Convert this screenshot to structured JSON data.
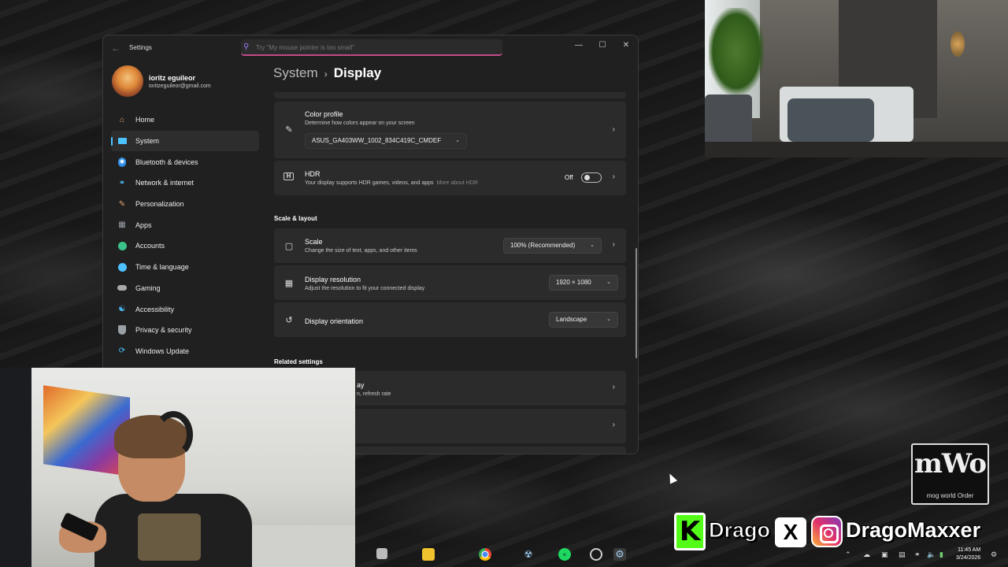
{
  "window": {
    "app_title": "Settings",
    "search_placeholder": "Try \"My mouse pointer is too small\"",
    "controls": {
      "minimize": "—",
      "maximize": "☐",
      "close": "✕"
    }
  },
  "profile": {
    "name": "ioritz eguileor",
    "email": "ioritzeguileor@gmail.com"
  },
  "sidebar": {
    "items": [
      {
        "label": "Home",
        "icon": "home-icon",
        "color": "#e8a36a"
      },
      {
        "label": "System",
        "icon": "system-icon",
        "color": "#4cc2ff"
      },
      {
        "label": "Bluetooth & devices",
        "icon": "bluetooth-icon",
        "color": "#2f8fe8"
      },
      {
        "label": "Network & internet",
        "icon": "wifi-icon",
        "color": "#4cc2ff"
      },
      {
        "label": "Personalization",
        "icon": "brush-icon",
        "color": "#e8a06a"
      },
      {
        "label": "Apps",
        "icon": "apps-icon",
        "color": "#9aa0a8"
      },
      {
        "label": "Accounts",
        "icon": "accounts-icon",
        "color": "#3ac28a"
      },
      {
        "label": "Time & language",
        "icon": "globe-icon",
        "color": "#4cc2ff"
      },
      {
        "label": "Gaming",
        "icon": "gamepad-icon",
        "color": "#aaaaaa"
      },
      {
        "label": "Accessibility",
        "icon": "accessibility-icon",
        "color": "#4cc2ff"
      },
      {
        "label": "Privacy & security",
        "icon": "shield-icon",
        "color": "#9aa0a8"
      },
      {
        "label": "Windows Update",
        "icon": "update-icon",
        "color": "#4cc2ff"
      }
    ]
  },
  "breadcrumb": {
    "parent": "System",
    "separator": "›",
    "current": "Display"
  },
  "cards": {
    "color_profile": {
      "title": "Color profile",
      "subtitle": "Determine how colors appear on your screen",
      "value": "ASUS_GA403WW_1002_834C419C_CMDEF"
    },
    "hdr": {
      "title": "HDR",
      "subtitle": "Your display supports HDR games, videos, and apps",
      "link": "More about HDR",
      "state": "Off"
    },
    "scale": {
      "title": "Scale",
      "subtitle": "Change the size of text, apps, and other items",
      "value": "100% (Recommended)"
    },
    "resolution": {
      "title": "Display resolution",
      "subtitle": "Adjust the resolution to fit your connected display",
      "value": "1920 × 1080"
    },
    "orientation": {
      "title": "Display orientation",
      "value": "Landscape"
    },
    "related_1": {
      "title_partial": "ay",
      "subtitle_partial": "n, refresh rate"
    }
  },
  "sections": {
    "scale_layout": "Scale & layout",
    "related": "Related settings"
  },
  "taskbar": {
    "clock_time": "11:45 AM",
    "clock_date": "3/24/2026"
  },
  "overlays": {
    "logo_mark": "mWo",
    "logo_text": "mog world Order",
    "kick_letter": "K",
    "kick_handle": "Drago",
    "x_letter": "X",
    "ig_handle": "DragoMaxxer"
  }
}
